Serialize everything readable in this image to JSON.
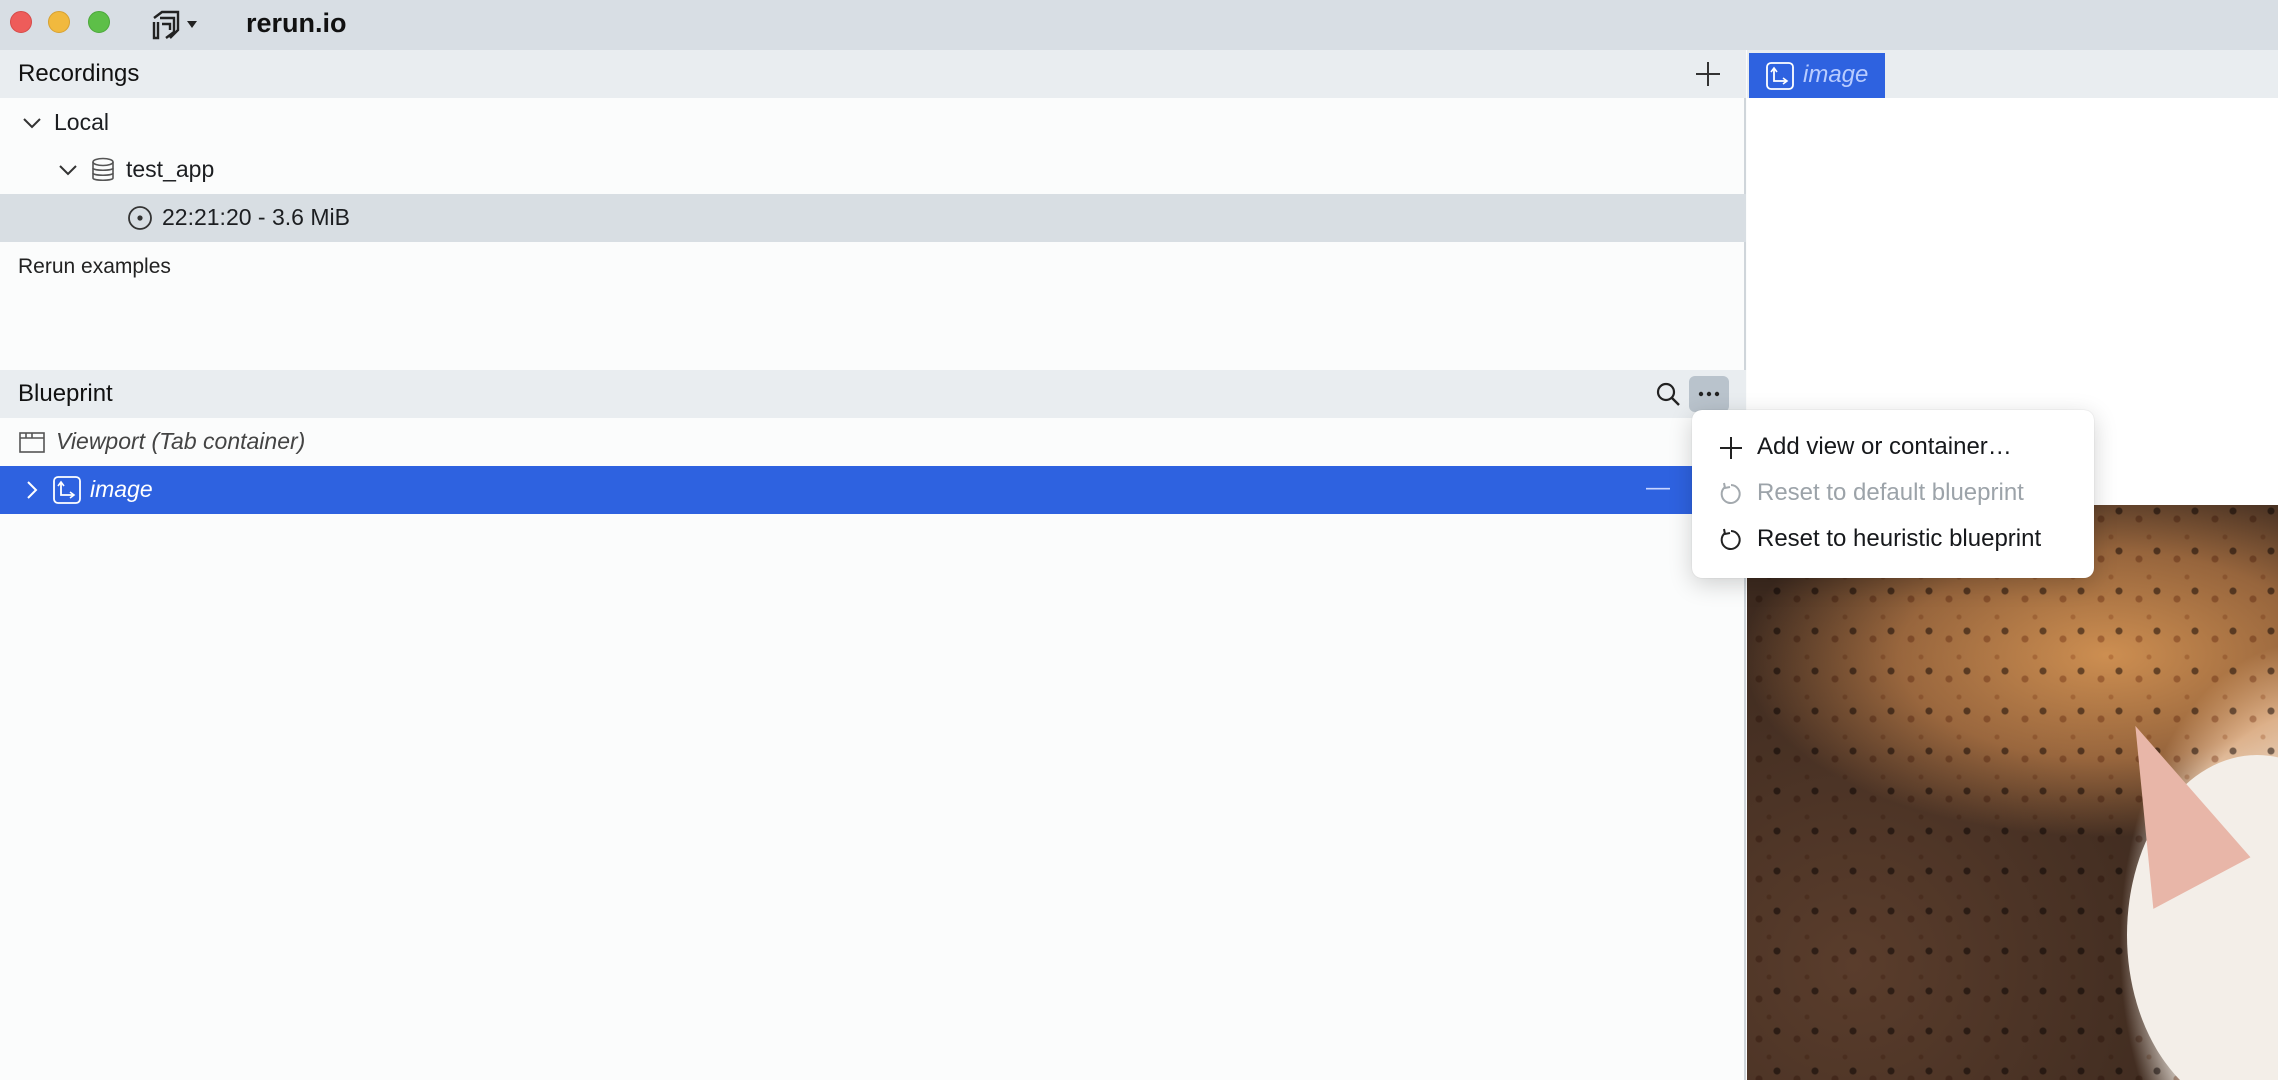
{
  "window": {
    "title": "rerun.io"
  },
  "recordings": {
    "header": "Recordings",
    "add_label": "+",
    "local_label": "Local",
    "app_id": "test_app",
    "recording_label": "22:21:20 - 3.6 MiB",
    "examples_label": "Rerun examples"
  },
  "blueprint": {
    "header": "Blueprint",
    "viewport_label": "Viewport (Tab container)",
    "view_label": "image",
    "remove_label": "—"
  },
  "context_menu": {
    "items": [
      {
        "label": "Add view or container…",
        "icon": "plus-icon",
        "enabled": true
      },
      {
        "label": "Reset to default blueprint",
        "icon": "reset-icon",
        "enabled": false
      },
      {
        "label": "Reset to heuristic blueprint",
        "icon": "reset-icon",
        "enabled": true
      }
    ]
  },
  "viewer": {
    "tab_label": "image"
  },
  "colors": {
    "accent": "#2e62e0",
    "titlebar": "#d8dee4",
    "panel_header": "#e9edf0",
    "selected_row": "#d8dee3"
  }
}
